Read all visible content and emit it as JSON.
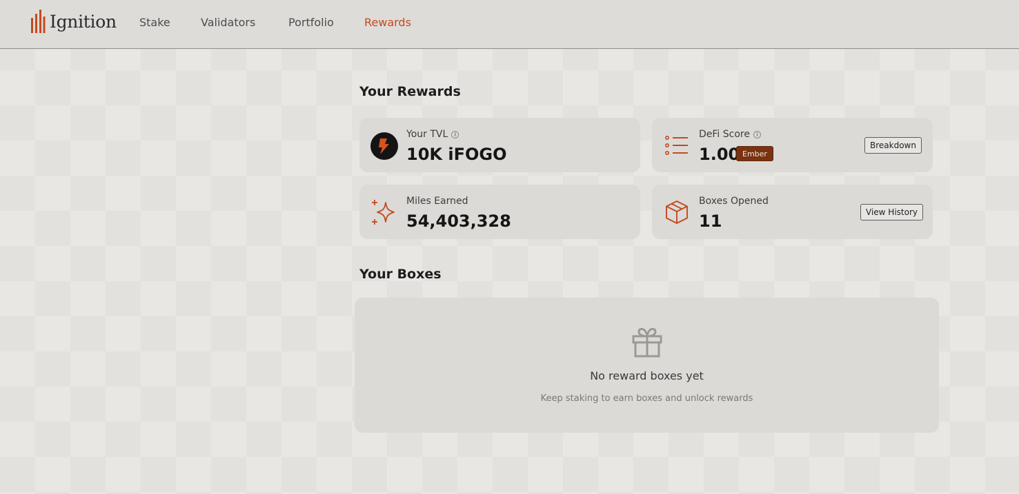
{
  "app": {
    "name": "Ignition"
  },
  "nav": {
    "items": [
      {
        "label": "Stake"
      },
      {
        "label": "Validators"
      },
      {
        "label": "Portfolio"
      },
      {
        "label": "Rewards"
      }
    ],
    "active": "Rewards"
  },
  "rewards": {
    "title": "Your Rewards",
    "tvl": {
      "label": "Your TVL",
      "value": "10K iFOGO",
      "icon": "fogo-bolt-icon"
    },
    "defi": {
      "label": "DeFi Score",
      "value": "1.00",
      "badge": "Ember",
      "button": "Breakdown",
      "icon": "list-icon"
    },
    "miles": {
      "label": "Miles Earned",
      "value": "54,403,328",
      "icon": "sparkle-icon"
    },
    "boxes": {
      "label": "Boxes Opened",
      "value": "11",
      "button": "View History",
      "icon": "box-icon"
    }
  },
  "your_boxes": {
    "title": "Your Boxes",
    "empty_title": "No reward boxes yet",
    "empty_subtitle": "Keep staking to earn boxes and unlock rewards",
    "icon": "gift-icon"
  },
  "colors": {
    "accent": "#c24a1f",
    "badge": "#7a3310",
    "card": "#dcdad7"
  }
}
